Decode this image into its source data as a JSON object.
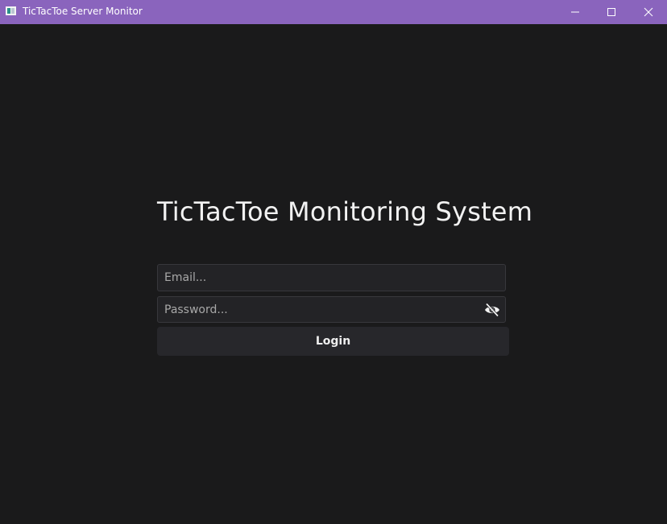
{
  "window": {
    "title": "TicTacToe Server Monitor",
    "titlebar_color": "#8a64bd",
    "controls": {
      "minimize_icon": "minimize-icon",
      "maximize_icon": "maximize-icon",
      "close_icon": "close-icon"
    }
  },
  "login": {
    "heading": "TicTacToe Monitoring System",
    "email": {
      "value": "",
      "placeholder": "Email..."
    },
    "password": {
      "value": "",
      "placeholder": "Password...",
      "toggle_icon": "eye-off-icon"
    },
    "submit_label": "Login"
  },
  "colors": {
    "background": "#1a1a1b",
    "input_background": "#232326",
    "button_background": "#27272b"
  }
}
